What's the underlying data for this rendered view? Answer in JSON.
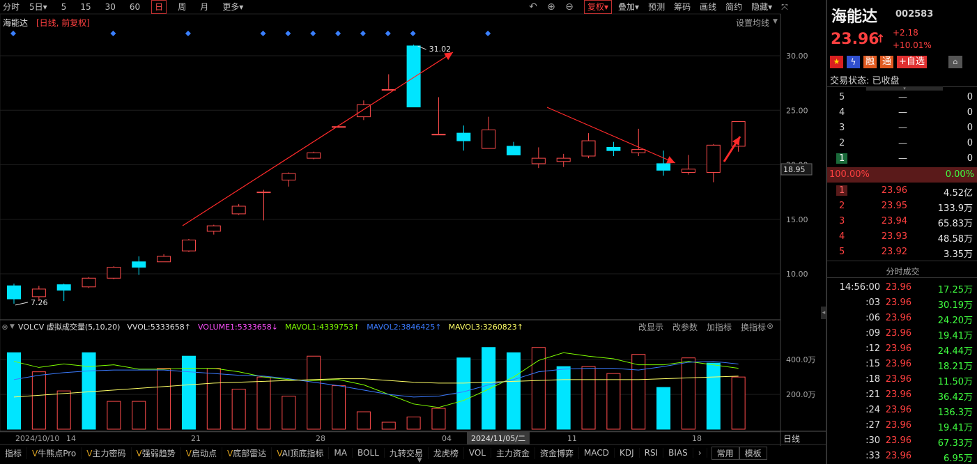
{
  "toolbar": {
    "left_items": [
      "分时",
      "5日▾",
      "5",
      "15",
      "30",
      "60",
      "日",
      "周",
      "月",
      "更多▾"
    ],
    "active_index": 6,
    "icons": [
      "undo-icon",
      "zoom-in-icon",
      "zoom-out-icon"
    ],
    "right_items": [
      "复权▾",
      "叠加▾",
      "预测",
      "筹码",
      "画线",
      "简约",
      "隐藏▾"
    ],
    "highlight_index": 0,
    "window_icon": "expand-icon"
  },
  "chart": {
    "stock_label": "海能达",
    "mode_label": "[日线, 前复权]",
    "settings_label": "设置均线",
    "last_price_tag": "18.95",
    "price_ticks": [
      "30.00",
      "25.00",
      "20.00",
      "15.00",
      "10.00"
    ],
    "high_annotation": "31.02",
    "low_annotation": "7.26",
    "vol_ticks": [
      "400.0万",
      "200.0万"
    ],
    "date_labels": [
      "2024/10/10",
      "14",
      "21",
      "28",
      "04",
      "2024/11/05/二",
      "11",
      "18"
    ],
    "period_label": "日线"
  },
  "chart_data": {
    "type": "candlestick",
    "candles": [
      {
        "o": 8.9,
        "c": 7.7,
        "h": 9.1,
        "l": 7.26,
        "up": false
      },
      {
        "o": 7.9,
        "c": 8.6,
        "h": 8.9,
        "l": 7.5,
        "up": true
      },
      {
        "o": 9.0,
        "c": 8.5,
        "h": 9.1,
        "l": 7.5,
        "up": false
      },
      {
        "o": 8.8,
        "c": 9.6,
        "h": 9.7,
        "l": 8.7,
        "up": true
      },
      {
        "o": 9.6,
        "c": 10.6,
        "h": 10.7,
        "l": 9.5,
        "up": true
      },
      {
        "o": 11.1,
        "c": 10.6,
        "h": 11.6,
        "l": 9.9,
        "up": false
      },
      {
        "o": 11.1,
        "c": 11.6,
        "h": 11.8,
        "l": 11.1,
        "up": true
      },
      {
        "o": 12.1,
        "c": 13.1,
        "h": 13.2,
        "l": 12.0,
        "up": true
      },
      {
        "o": 13.9,
        "c": 14.4,
        "h": 14.5,
        "l": 13.6,
        "up": true
      },
      {
        "o": 15.5,
        "c": 16.2,
        "h": 16.4,
        "l": 15.4,
        "up": true
      },
      {
        "o": 17.5,
        "c": 17.5,
        "h": 17.7,
        "l": 14.9,
        "up": true
      },
      {
        "o": 18.6,
        "c": 19.2,
        "h": 19.3,
        "l": 18.0,
        "up": true
      },
      {
        "o": 20.6,
        "c": 21.1,
        "h": 21.2,
        "l": 20.5,
        "up": true
      },
      {
        "o": 23.5,
        "c": 23.5,
        "h": 23.6,
        "l": 23.4,
        "up": true
      },
      {
        "o": 24.4,
        "c": 25.5,
        "h": 25.9,
        "l": 24.1,
        "up": true
      },
      {
        "o": 26.9,
        "c": 26.9,
        "h": 28.3,
        "l": 26.9,
        "up": true
      },
      {
        "o": 30.9,
        "c": 25.3,
        "h": 31.02,
        "l": 25.3,
        "up": false
      },
      {
        "o": 22.8,
        "c": 22.8,
        "h": 26.2,
        "l": 22.8,
        "up": true
      },
      {
        "o": 22.9,
        "c": 22.2,
        "h": 23.6,
        "l": 21.3,
        "up": false
      },
      {
        "o": 21.5,
        "c": 23.2,
        "h": 24.4,
        "l": 21.5,
        "up": true
      },
      {
        "o": 21.7,
        "c": 20.9,
        "h": 22.1,
        "l": 20.9,
        "up": false
      },
      {
        "o": 20.1,
        "c": 20.6,
        "h": 21.6,
        "l": 19.7,
        "up": true
      },
      {
        "o": 20.3,
        "c": 20.6,
        "h": 21.0,
        "l": 19.8,
        "up": true
      },
      {
        "o": 20.8,
        "c": 22.2,
        "h": 22.9,
        "l": 20.6,
        "up": true
      },
      {
        "o": 21.6,
        "c": 21.3,
        "h": 22.1,
        "l": 20.8,
        "up": false
      },
      {
        "o": 21.1,
        "c": 21.4,
        "h": 23.3,
        "l": 20.8,
        "up": true
      },
      {
        "o": 20.1,
        "c": 19.5,
        "h": 21.3,
        "l": 19.0,
        "up": false
      },
      {
        "o": 19.3,
        "c": 19.6,
        "h": 20.9,
        "l": 19.1,
        "up": true
      },
      {
        "o": 19.3,
        "c": 21.8,
        "h": 21.9,
        "l": 18.4,
        "up": true
      },
      {
        "o": 21.7,
        "c": 23.96,
        "h": 23.96,
        "l": 21.2,
        "up": true
      }
    ],
    "signal_days": [
      0,
      4,
      7,
      10,
      11,
      12,
      13,
      14,
      15,
      16,
      19
    ],
    "volumes": [
      440,
      330,
      220,
      440,
      160,
      160,
      350,
      420,
      350,
      230,
      300,
      190,
      420,
      250,
      100,
      40,
      70,
      120,
      410,
      470,
      440,
      470,
      360,
      360,
      320,
      430,
      240,
      410,
      380,
      300,
      490,
      490
    ],
    "vol_up": [
      false,
      true,
      true,
      false,
      true,
      true,
      true,
      false,
      true,
      true,
      true,
      true,
      true,
      true,
      true,
      true,
      true,
      true,
      false,
      false,
      false,
      true,
      false,
      true,
      true,
      true,
      false,
      true,
      false,
      true,
      true,
      true
    ],
    "ma_series": [
      {
        "name": "MAVOL1",
        "values": [
          390,
          355,
          375,
          360,
          370,
          345,
          345,
          350,
          350,
          330,
          300,
          285,
          280,
          285,
          255,
          200,
          145,
          125,
          165,
          230,
          300,
          395,
          440,
          420,
          405,
          370,
          370,
          390,
          370,
          350,
          380,
          420
        ]
      },
      {
        "name": "MAVOL2",
        "values": [
          285,
          310,
          325,
          335,
          340,
          340,
          340,
          330,
          320,
          310,
          305,
          290,
          270,
          250,
          225,
          200,
          185,
          190,
          215,
          255,
          285,
          330,
          345,
          350,
          350,
          340,
          360,
          385,
          390,
          375,
          380,
          385
        ]
      },
      {
        "name": "MAVOL3",
        "values": [
          185,
          195,
          205,
          215,
          225,
          235,
          245,
          255,
          265,
          270,
          275,
          280,
          285,
          290,
          290,
          280,
          270,
          265,
          265,
          270,
          275,
          280,
          285,
          285,
          285,
          285,
          290,
          295,
          300,
          305,
          315,
          325
        ]
      }
    ]
  },
  "indicator_bar": {
    "name": "VOLCV 虚拟成交量(5,10,20)",
    "vvol": "VVOL:5333658↑",
    "volume1": "VOLUME1:5333658↓",
    "mavol1": "MAVOL1:4339753↑",
    "mavol2": "MAVOL2:3846425↑",
    "mavol3": "MAVOL3:3260823↑",
    "actions": [
      "改显示",
      "改参数",
      "加指标",
      "换指标"
    ]
  },
  "colors": {
    "up": "#ff4c4c",
    "down": "#00e5ff",
    "mavol1": "#7fff00",
    "mavol2": "#3b7bff",
    "mavol3": "#ffff66",
    "volume1": "#ff50ff"
  },
  "bottom_tabs": [
    "指标",
    "V牛熊点Pro",
    "V主力密码",
    "V强弱趋势",
    "V启动点",
    "V底部雷达",
    "VAI顶底指标",
    "MA",
    "BOLL",
    "九转交易",
    "龙虎榜",
    "VOL",
    "主力资金",
    "资金博弈",
    "MACD",
    "KDJ",
    "RSI",
    "BIAS",
    "›",
    "常用",
    "模板"
  ],
  "quote": {
    "name": "海能达",
    "code": "002583",
    "price": "23.96",
    "change": "+2.18",
    "pct": "+10.01%",
    "badges": [
      "融",
      "通",
      "+自选"
    ],
    "status_label": "交易状态: 已收盘",
    "sell_levels": [
      {
        "level": "5",
        "price": "—",
        "vol": "0"
      },
      {
        "level": "4",
        "price": "—",
        "vol": "0"
      },
      {
        "level": "3",
        "price": "—",
        "vol": "0"
      },
      {
        "level": "2",
        "price": "—",
        "vol": "0"
      },
      {
        "level": "1",
        "price": "—",
        "vol": "0"
      }
    ],
    "ratio_left": "100.00%",
    "ratio_right": "0.00%",
    "buy_levels": [
      {
        "level": "1",
        "price": "23.96",
        "vol": "4.52亿"
      },
      {
        "level": "2",
        "price": "23.95",
        "vol": "133.9万"
      },
      {
        "level": "3",
        "price": "23.94",
        "vol": "65.83万"
      },
      {
        "level": "4",
        "price": "23.93",
        "vol": "48.58万"
      },
      {
        "level": "5",
        "price": "23.92",
        "vol": "3.35万"
      }
    ],
    "ticks_title": "分时成交",
    "ticks": [
      {
        "time": "14:56:00",
        "price": "23.96",
        "vol": "17.25万"
      },
      {
        "time": ":03",
        "price": "23.96",
        "vol": "30.19万"
      },
      {
        "time": ":06",
        "price": "23.96",
        "vol": "24.20万"
      },
      {
        "time": ":09",
        "price": "23.96",
        "vol": "19.41万"
      },
      {
        "time": ":12",
        "price": "23.96",
        "vol": "24.44万"
      },
      {
        "time": ":15",
        "price": "23.96",
        "vol": "18.21万"
      },
      {
        "time": ":18",
        "price": "23.96",
        "vol": "11.50万"
      },
      {
        "time": ":21",
        "price": "23.96",
        "vol": "36.42万"
      },
      {
        "time": ":24",
        "price": "23.96",
        "vol": "136.3万"
      },
      {
        "time": ":27",
        "price": "23.96",
        "vol": "19.41万"
      },
      {
        "time": ":30",
        "price": "23.96",
        "vol": "67.33万"
      },
      {
        "time": ":33",
        "price": "23.96",
        "vol": "6.95万"
      }
    ]
  }
}
